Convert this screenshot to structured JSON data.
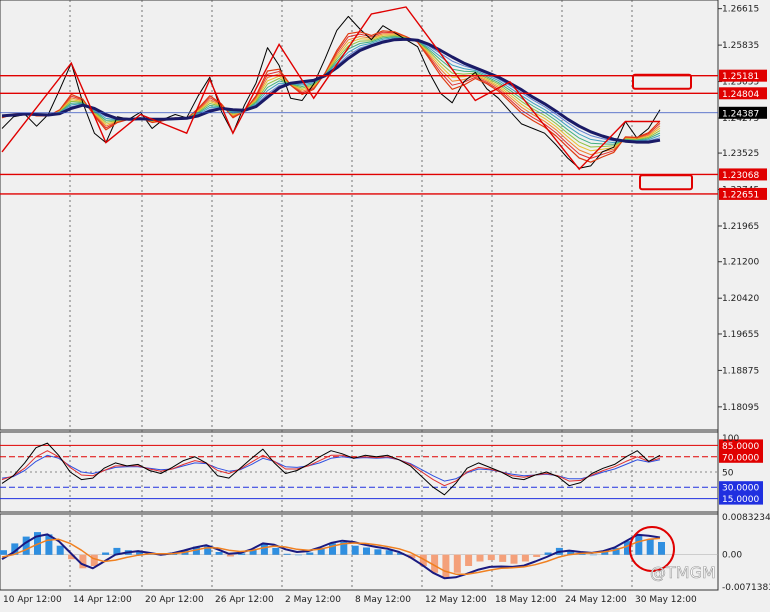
{
  "chart_data": [
    {
      "type": "line",
      "panel": "main-price",
      "y_ticks": [
        "1.26615",
        "1.25835",
        "1.25055",
        "1.24275",
        "1.23525",
        "1.22745",
        "1.21965",
        "1.21200",
        "1.20420",
        "1.19655",
        "1.18875",
        "1.18095"
      ],
      "ylim": [
        1.176,
        1.268
      ],
      "grid": "vertical-dotted",
      "price_levels": [
        {
          "value": 1.25181,
          "label": "1.25181",
          "color": "#e00000"
        },
        {
          "value": 1.24804,
          "label": "1.24804",
          "color": "#e00000"
        },
        {
          "value": 1.24387,
          "label": "1.24387",
          "color": "#000000"
        },
        {
          "value": 1.23068,
          "label": "1.23068",
          "color": "#e00000"
        },
        {
          "value": 1.22651,
          "label": "1.22651",
          "color": "#e00000"
        }
      ],
      "series": [
        {
          "values": [
            1.2405,
            1.243,
            1.2435,
            1.241,
            1.2435,
            1.2488,
            1.2545,
            1.246,
            1.2395,
            1.2375,
            1.243,
            1.2425,
            1.244,
            1.2405,
            1.2425,
            1.2435,
            1.2428,
            1.2475,
            1.2515,
            1.2442,
            1.2395,
            1.2455,
            1.2502,
            1.2578,
            1.254,
            1.247,
            1.2465,
            1.25,
            1.2555,
            1.2615,
            1.2645,
            1.2618,
            1.2595,
            1.2625,
            1.261,
            1.2595,
            1.258,
            1.2525,
            1.248,
            1.246,
            1.2505,
            1.2525,
            1.249,
            1.247,
            1.2442,
            1.2415,
            1.2405,
            1.2395,
            1.237,
            1.2342,
            1.232,
            1.2325,
            1.2355,
            1.2365,
            1.242,
            1.2385,
            1.2405,
            1.2445
          ],
          "color": "#000000"
        },
        {
          "values": [
            1.2428,
            1.2436,
            1.2438,
            1.2432,
            1.2432,
            1.2445,
            1.2478,
            1.2468,
            1.2432,
            1.2402,
            1.2418,
            1.2425,
            1.2428,
            1.2418,
            1.2422,
            1.2428,
            1.2426,
            1.2448,
            1.2475,
            1.2458,
            1.2428,
            1.2442,
            1.2475,
            1.2528,
            1.2532,
            1.2498,
            1.2478,
            1.2489,
            1.2524,
            1.2572,
            1.2608,
            1.2612,
            1.2604,
            1.2614,
            1.2612,
            1.2602,
            1.259,
            1.2555,
            1.2518,
            1.2489,
            1.2498,
            1.2512,
            1.2501,
            1.2485,
            1.2462,
            1.2438,
            1.2422,
            1.2408,
            1.2389,
            1.2365,
            1.2342,
            1.2333,
            1.2344,
            1.2354,
            1.2387,
            1.2386,
            1.2396,
            1.2421
          ],
          "color": "#e03a10"
        },
        {
          "values": [
            1.2432,
            1.2434,
            1.2436,
            1.2435,
            1.2434,
            1.2437,
            1.2448,
            1.2455,
            1.2448,
            1.2435,
            1.2426,
            1.2425,
            1.2426,
            1.2425,
            1.2425,
            1.2426,
            1.2427,
            1.2432,
            1.2442,
            1.2448,
            1.2445,
            1.2444,
            1.2452,
            1.2472,
            1.2492,
            1.2502,
            1.2505,
            1.2508,
            1.2518,
            1.2535,
            1.2555,
            1.2572,
            1.2582,
            1.259,
            1.2595,
            1.2596,
            1.2594,
            1.2585,
            1.2572,
            1.2558,
            1.2545,
            1.2535,
            1.2525,
            1.2515,
            1.2502,
            1.2488,
            1.2472,
            1.2458,
            1.2442,
            1.2425,
            1.241,
            1.2398,
            1.2389,
            1.2382,
            1.2378,
            1.2376,
            1.2376,
            1.238
          ],
          "color": "#1a1a66"
        }
      ]
    },
    {
      "type": "line",
      "panel": "oscillator",
      "y_ticks": [
        "100"
      ],
      "levels": [
        {
          "value": 85,
          "label": "85.0000",
          "color": "#e00000"
        },
        {
          "value": 70,
          "label": "70.0000",
          "color": "#e00000"
        },
        {
          "value": 50,
          "label": "50",
          "color": "#888888"
        },
        {
          "value": 30,
          "label": "30.0000",
          "color": "#2030e0"
        },
        {
          "value": 15,
          "label": "15.0000",
          "color": "#2030e0"
        }
      ],
      "ylim": [
        0,
        100
      ],
      "series": [
        {
          "values": [
            35,
            45,
            62,
            82,
            88,
            72,
            50,
            40,
            42,
            55,
            62,
            58,
            60,
            52,
            48,
            56,
            65,
            70,
            62,
            45,
            42,
            55,
            68,
            80,
            62,
            48,
            52,
            60,
            70,
            78,
            74,
            68,
            72,
            70,
            72,
            66,
            58,
            44,
            30,
            20,
            35,
            55,
            62,
            56,
            50,
            42,
            40,
            46,
            50,
            44,
            32,
            36,
            48,
            55,
            60,
            70,
            78,
            64,
            72
          ],
          "color": "#000000"
        },
        {
          "values": [
            40,
            45,
            55,
            70,
            78,
            70,
            56,
            46,
            45,
            52,
            58,
            58,
            58,
            54,
            51,
            54,
            60,
            65,
            62,
            52,
            48,
            54,
            63,
            72,
            64,
            54,
            54,
            58,
            65,
            72,
            72,
            69,
            70,
            69,
            70,
            66,
            60,
            50,
            40,
            32,
            38,
            50,
            56,
            54,
            50,
            45,
            43,
            46,
            48,
            45,
            38,
            39,
            46,
            52,
            57,
            64,
            70,
            64,
            68
          ],
          "color": "#e03030"
        },
        {
          "values": [
            42,
            44,
            52,
            64,
            72,
            68,
            58,
            50,
            48,
            52,
            56,
            57,
            57,
            55,
            53,
            54,
            58,
            62,
            61,
            55,
            51,
            53,
            60,
            68,
            64,
            57,
            56,
            58,
            62,
            68,
            70,
            68,
            69,
            68,
            69,
            66,
            61,
            53,
            45,
            38,
            41,
            49,
            54,
            53,
            50,
            47,
            45,
            46,
            47,
            45,
            41,
            41,
            45,
            50,
            54,
            60,
            66,
            63,
            66
          ],
          "color": "#3050e0"
        }
      ]
    },
    {
      "type": "bar",
      "panel": "macd",
      "y_ticks": [
        "0.0083234",
        "0.00",
        "-0.0071383"
      ],
      "ylim": [
        -0.0078,
        0.009
      ],
      "values": [
        0.001,
        0.0025,
        0.004,
        0.005,
        0.0045,
        0.002,
        -0.001,
        -0.003,
        -0.0025,
        0.0005,
        0.0015,
        0.001,
        0.0008,
        0.0002,
        0.0,
        0.0005,
        0.001,
        0.0018,
        0.002,
        0.0006,
        -0.0004,
        0.0003,
        0.0012,
        0.0025,
        0.0015,
        0.0002,
        0.0,
        0.0005,
        0.0015,
        0.0025,
        0.0028,
        0.002,
        0.0016,
        0.0012,
        0.001,
        0.0004,
        -0.0008,
        -0.0025,
        -0.004,
        -0.005,
        -0.004,
        -0.0025,
        -0.0015,
        -0.0012,
        -0.0016,
        -0.002,
        -0.0015,
        -0.0005,
        0.0005,
        0.0015,
        0.001,
        0.0002,
        0.0,
        0.0006,
        0.0015,
        0.003,
        0.0045,
        0.0035,
        0.0028
      ],
      "series": [
        {
          "values": [
            -0.001,
            0.0005,
            0.0025,
            0.004,
            0.0045,
            0.003,
            0.0005,
            -0.002,
            -0.003,
            -0.0015,
            0.0,
            0.0005,
            0.0008,
            0.0004,
            0.0,
            0.0003,
            0.0009,
            0.0016,
            0.0021,
            0.0012,
            0.0002,
            0.0004,
            0.0012,
            0.0025,
            0.0022,
            0.0012,
            0.0006,
            0.0008,
            0.0016,
            0.0026,
            0.0031,
            0.0028,
            0.0022,
            0.0017,
            0.0013,
            0.0006,
            -0.0006,
            -0.0022,
            -0.004,
            -0.0052,
            -0.005,
            -0.0042,
            -0.0033,
            -0.0027,
            -0.0026,
            -0.0027,
            -0.0024,
            -0.0015,
            -0.0005,
            0.0006,
            0.0009,
            0.0006,
            0.0004,
            0.0008,
            0.0016,
            0.003,
            0.0044,
            0.0042,
            0.0038
          ],
          "color": "#1a1a80"
        },
        {
          "values": [
            -0.0005,
            0.0,
            0.001,
            0.0022,
            0.0032,
            0.0034,
            0.0025,
            0.001,
            -0.0008,
            -0.0015,
            -0.0012,
            -0.0006,
            -0.0001,
            0.0002,
            0.0002,
            0.0002,
            0.0005,
            0.001,
            0.0015,
            0.0015,
            0.001,
            0.0007,
            0.0009,
            0.0015,
            0.0019,
            0.0017,
            0.0012,
            0.001,
            0.0012,
            0.0018,
            0.0024,
            0.0026,
            0.0025,
            0.0022,
            0.0018,
            0.0013,
            0.0005,
            -0.0008,
            -0.0022,
            -0.0036,
            -0.0043,
            -0.0043,
            -0.0039,
            -0.0034,
            -0.003,
            -0.0029,
            -0.0027,
            -0.0022,
            -0.0015,
            -0.0006,
            0.0,
            0.0003,
            0.0004,
            0.0006,
            0.001,
            0.0018,
            0.0028,
            0.0034,
            0.0036
          ],
          "color": "#f08020"
        }
      ]
    }
  ],
  "time_labels": [
    "10 Apr 12:00",
    "14 Apr 12:00",
    "20 Apr 12:00",
    "26 Apr 12:00",
    "2 May 12:00",
    "8 May 12:00",
    "12 May 12:00",
    "18 May 12:00",
    "24 May 12:00",
    "30 May 12:00"
  ],
  "watermark": "@TMGM",
  "colors": {
    "background": "#f0f0f0",
    "level_red": "#e00000",
    "histogram_up": "#2f8fe0",
    "histogram_down": "#f4a07a",
    "annotation": "#e00000"
  }
}
